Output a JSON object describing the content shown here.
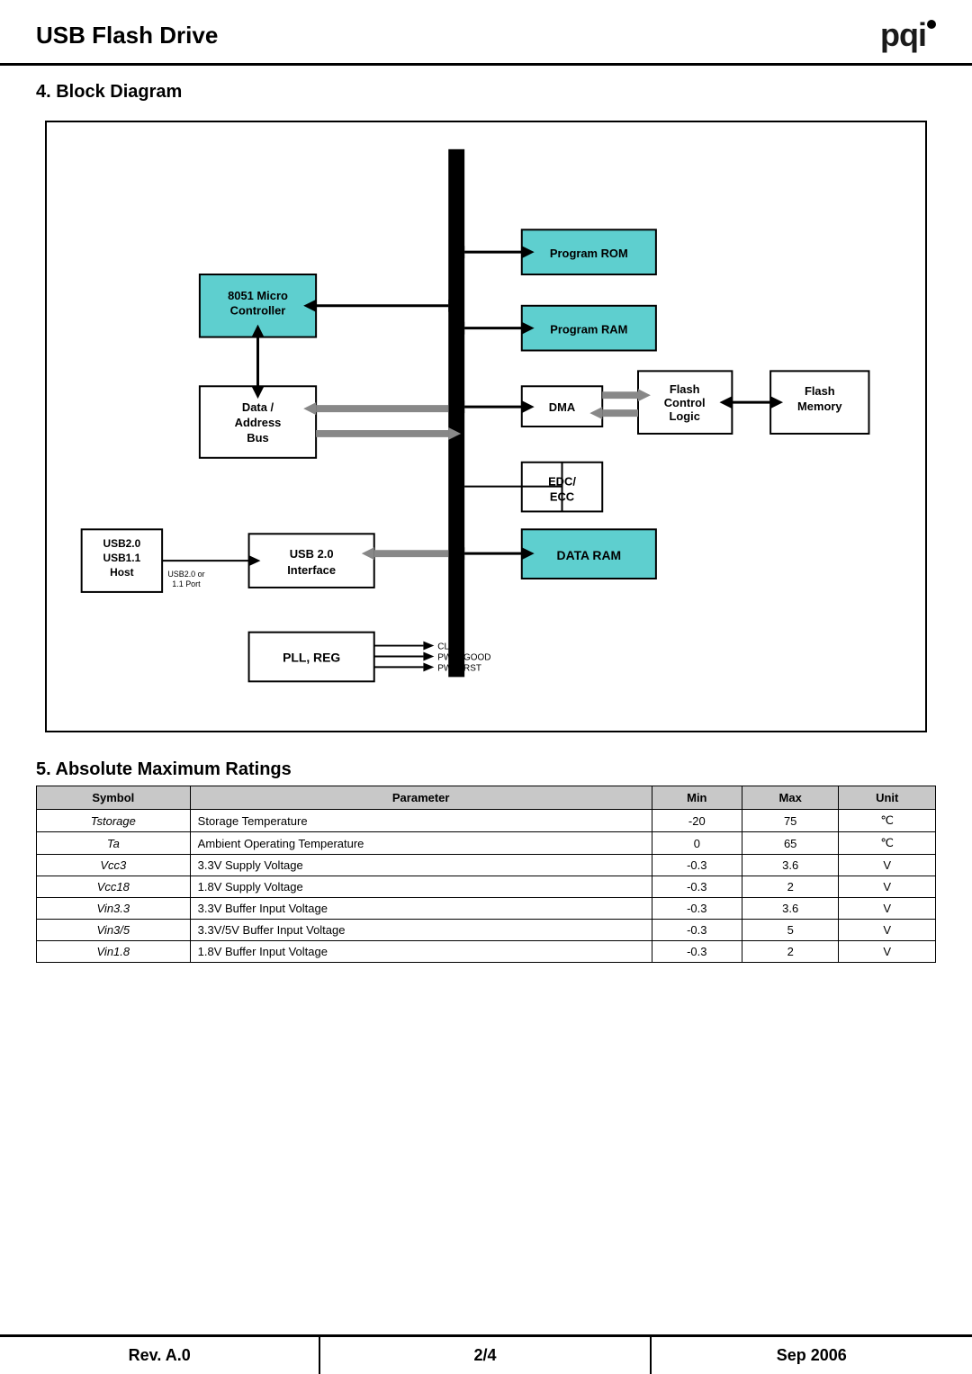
{
  "header": {
    "title": "USB Flash Drive",
    "logo": "pqi"
  },
  "section4": {
    "heading": "4. Block Diagram"
  },
  "section5": {
    "heading": "5. Absolute Maximum Ratings"
  },
  "diagram": {
    "blocks": {
      "micro_controller": "8051 Micro\nController",
      "program_rom": "Program ROM",
      "program_ram": "Program RAM",
      "dma": "DMA",
      "flash_control": "Flash\nControl\nLogic",
      "flash_memory": "Flash\nMemory",
      "data_bus": "Data /\nAddress\nBus",
      "edc_ecc": "EDC/\nECC",
      "usb_interface": "USB 2.0\nInterface",
      "data_ram": "DATA RAM",
      "pll_reg": "PLL, REG",
      "usb_host": "USB2.0\nUSB1.1\nHost",
      "pll_clk": "CLK",
      "pll_pwr_good": "PWR_GOOD",
      "pll_pwr_rst": "PWR_RST",
      "usb_port_label": "USB2.0 or\n1.1 Port"
    }
  },
  "table": {
    "columns": [
      "Symbol",
      "Parameter",
      "Min",
      "Max",
      "Unit"
    ],
    "rows": [
      [
        "Tstorage",
        "Storage Temperature",
        "-20",
        "75",
        "℃"
      ],
      [
        "Ta",
        "Ambient Operating Temperature",
        "0",
        "65",
        "℃"
      ],
      [
        "Vcc3",
        "3.3V Supply Voltage",
        "-0.3",
        "3.6",
        "V"
      ],
      [
        "Vcc18",
        "1.8V Supply Voltage",
        "-0.3",
        "2",
        "V"
      ],
      [
        "Vin3.3",
        "3.3V Buffer Input Voltage",
        "-0.3",
        "3.6",
        "V"
      ],
      [
        "Vin3/5",
        "3.3V/5V Buffer Input Voltage",
        "-0.3",
        "5",
        "V"
      ],
      [
        "Vin1.8",
        "1.8V Buffer Input Voltage",
        "-0.3",
        "2",
        "V"
      ]
    ]
  },
  "footer": {
    "left": "Rev. A.0",
    "mid": "2/4",
    "right": "Sep 2006"
  }
}
